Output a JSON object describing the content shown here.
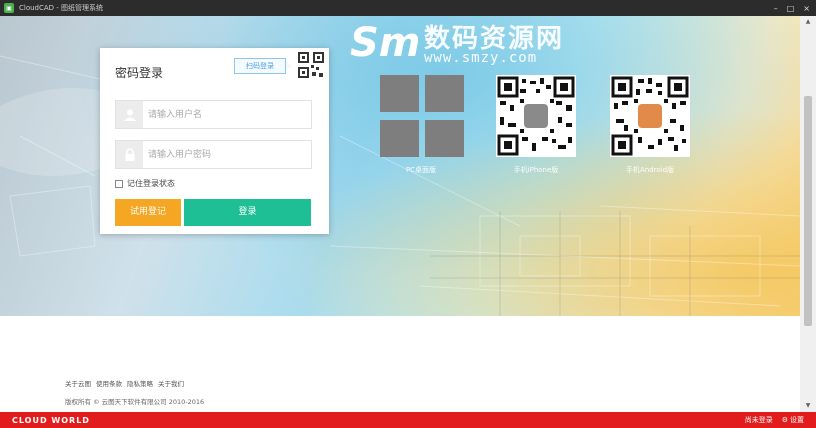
{
  "titlebar": {
    "title": "CloudCAD - 图纸管理系统",
    "minimize": "–",
    "maximize": "□",
    "close": "×"
  },
  "brand": {
    "logo_letters": "Sm",
    "name": "数码资源网",
    "url": "www.smzy.com"
  },
  "login": {
    "title": "密码登录",
    "qr_login_label": "扫码登录",
    "username_placeholder": "请输入用户名",
    "password_placeholder": "请输入用户密码",
    "remember_label": "记住登录状态",
    "trial_button": "试用登记",
    "login_button": "登录"
  },
  "downloads": [
    {
      "label": "PC桌面版",
      "icon": "windows-icon"
    },
    {
      "label": "手机iPhone版",
      "icon": "apple-icon"
    },
    {
      "label": "手机Android版",
      "icon": "android-icon"
    }
  ],
  "footer": {
    "links": [
      "关于云图",
      "使用条款",
      "隐私策略",
      "关于我们"
    ],
    "copyright": "版权所有 © 云图天下软件有限公司 2010-2016"
  },
  "statusbar": {
    "brand": "CLOUD WORLD",
    "not_logged_in": "尚未登录",
    "settings": "设置"
  },
  "colors": {
    "trial": "#f5a623",
    "login": "#1fbf95",
    "statusbar": "#e21c1c",
    "titlebar": "#2c2c2c"
  }
}
